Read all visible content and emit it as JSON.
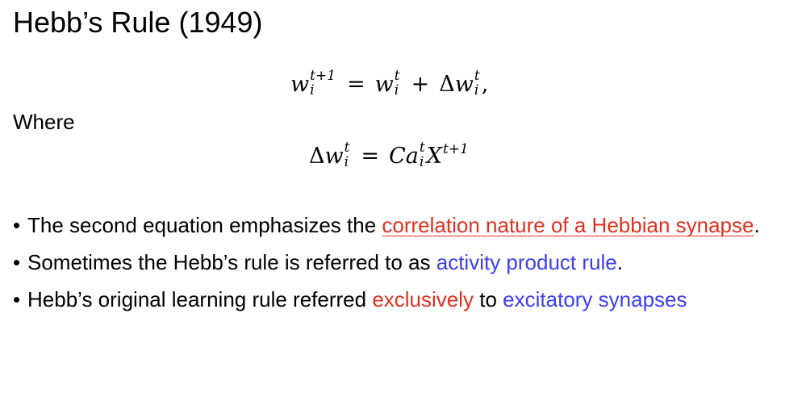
{
  "title": "Hebb’s Rule (1949)",
  "where_label": "Where",
  "equations": {
    "eq1": {
      "lhs_base": "w",
      "lhs_sup": "t+1",
      "lhs_sub": "i",
      "equals": "=",
      "r1_base": "w",
      "r1_sup": "t",
      "r1_sub": "i",
      "plus": "+",
      "delta": "Δ",
      "r2_base": "w",
      "r2_sup": "t",
      "r2_sub": "i",
      "trail": ","
    },
    "eq2": {
      "delta": "Δ",
      "lhs_base": "w",
      "lhs_sup": "t",
      "lhs_sub": "i",
      "equals": "=",
      "coef": "C",
      "a_base": "a",
      "a_sup": "t",
      "a_sub": "i",
      "x_base": "X",
      "x_sup": "t+1"
    }
  },
  "bullets": [
    {
      "dot": "•",
      "before": "The second equation emphasizes the ",
      "red_link": "correlation nature of a Hebbian synapse",
      "after": "."
    },
    {
      "dot": "•",
      "before": "Sometimes the Hebb’s rule is referred to as ",
      "blue": "activity product rule",
      "after": "."
    },
    {
      "dot": "•",
      "before": "Hebb’s original learning rule referred ",
      "red": "exclusively",
      "middle": " to ",
      "blue": "excitatory synapses"
    }
  ],
  "colors": {
    "red": "#e0301e",
    "blue": "#3a3df0",
    "text": "#000000",
    "background": "#ffffff"
  }
}
